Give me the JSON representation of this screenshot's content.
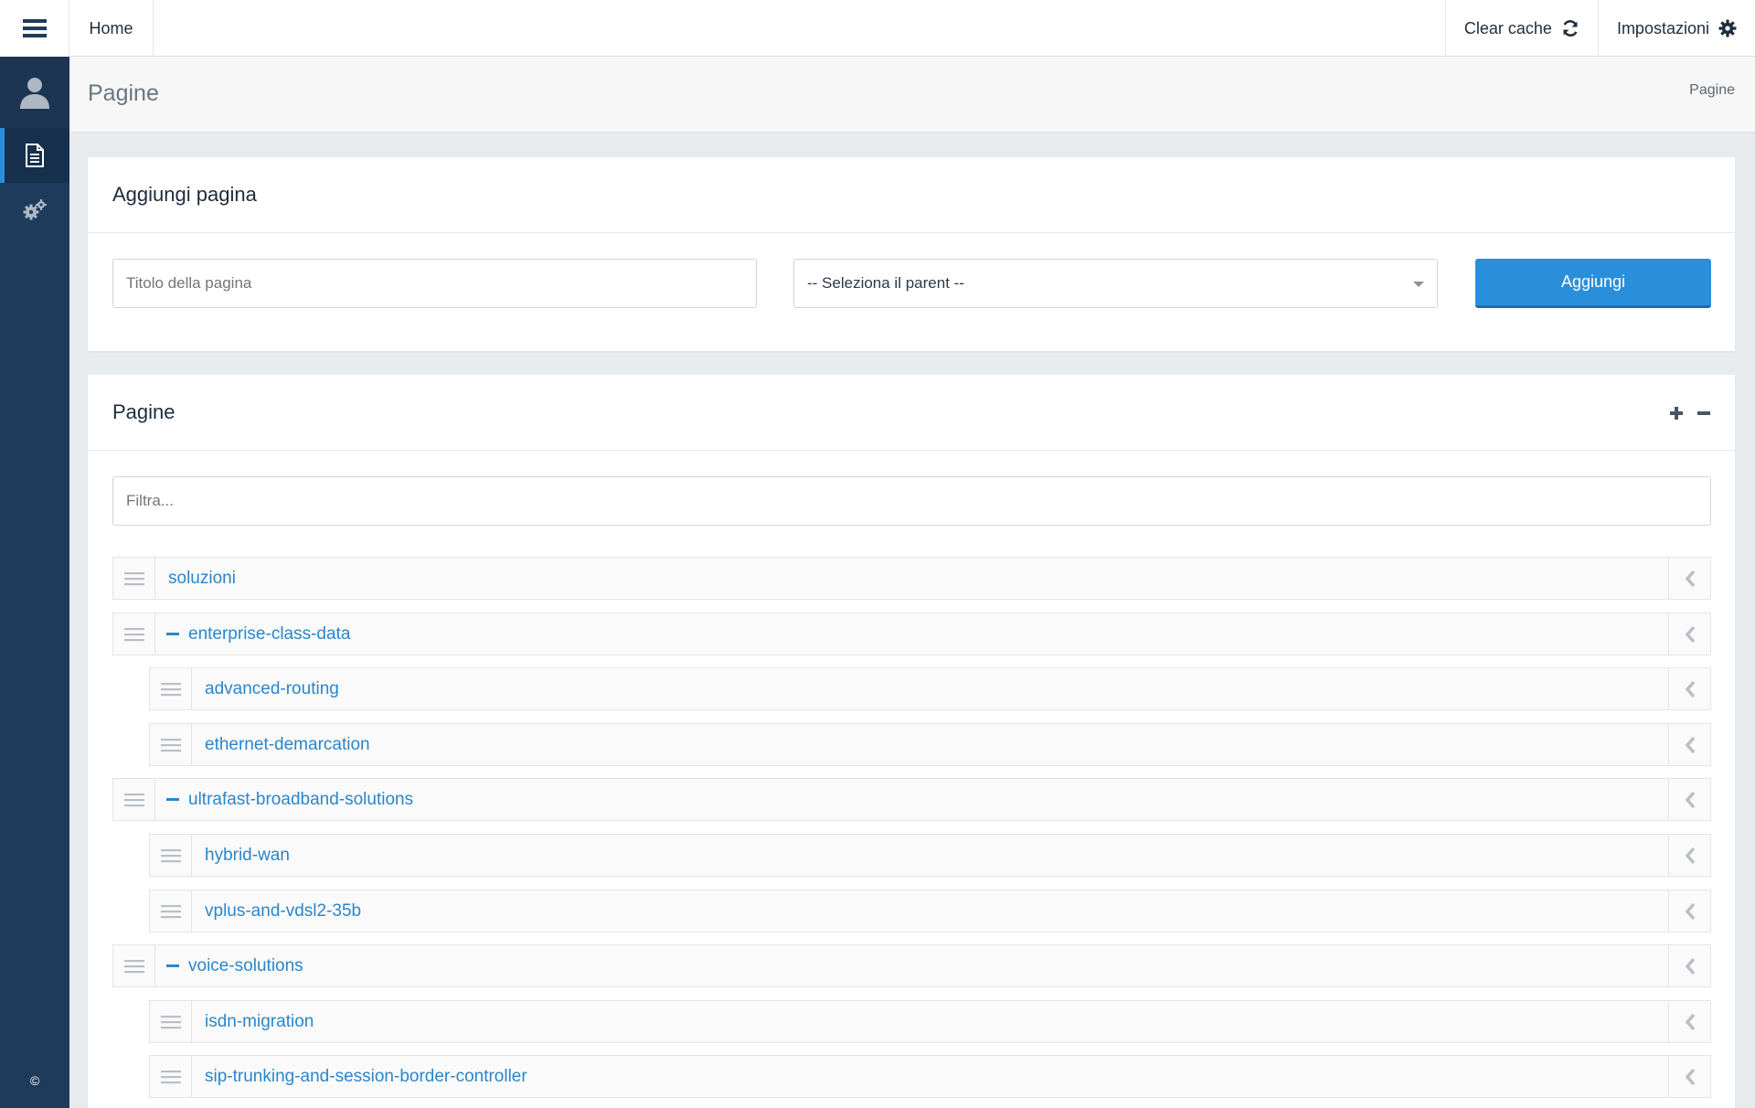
{
  "topbar": {
    "home_label": "Home",
    "clear_cache_label": "Clear cache",
    "settings_label": "Impostazioni"
  },
  "sidebar": {
    "copyright": "©"
  },
  "page_header": {
    "title": "Pagine",
    "breadcrumb": "Pagine"
  },
  "add_panel": {
    "title": "Aggiungi pagina",
    "title_placeholder": "Titolo della pagina",
    "parent_select_value": "-- Seleziona il parent --",
    "submit_label": "Aggiungi"
  },
  "pages_panel": {
    "title": "Pagine",
    "filter_placeholder": "Filtra...",
    "tree": [
      {
        "label": "soluzioni",
        "level": 0,
        "expanded": false,
        "has_children": false
      },
      {
        "label": "enterprise-class-data",
        "level": 0,
        "expanded": true,
        "has_children": true
      },
      {
        "label": "advanced-routing",
        "level": 1,
        "expanded": false,
        "has_children": false
      },
      {
        "label": "ethernet-demarcation",
        "level": 1,
        "expanded": false,
        "has_children": false
      },
      {
        "label": "ultrafast-broadband-solutions",
        "level": 0,
        "expanded": true,
        "has_children": true
      },
      {
        "label": "hybrid-wan",
        "level": 1,
        "expanded": false,
        "has_children": false
      },
      {
        "label": "vplus-and-vdsl2-35b",
        "level": 1,
        "expanded": false,
        "has_children": false
      },
      {
        "label": "voice-solutions",
        "level": 0,
        "expanded": true,
        "has_children": true
      },
      {
        "label": "isdn-migration",
        "level": 1,
        "expanded": false,
        "has_children": false
      },
      {
        "label": "sip-trunking-and-session-border-controller",
        "level": 1,
        "expanded": false,
        "has_children": false
      }
    ]
  },
  "colors": {
    "sidebar_bg": "#1f3b5c",
    "accent": "#2a8fdb",
    "link": "#2a86cc"
  }
}
